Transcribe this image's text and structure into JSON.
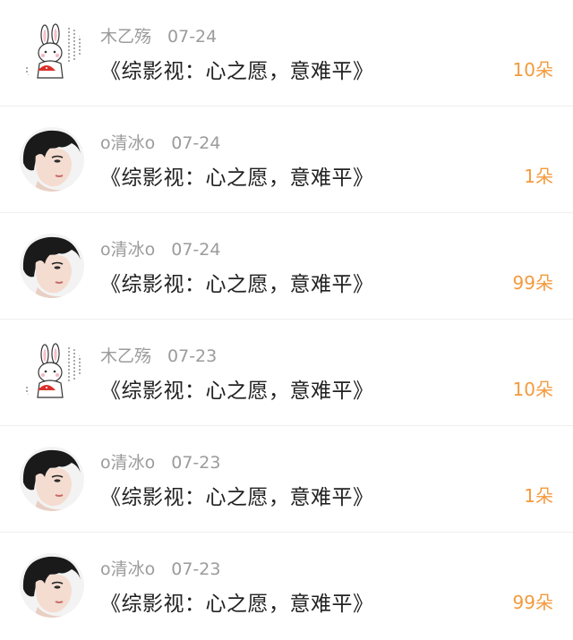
{
  "items": [
    {
      "avatar": "rabbit-avatar",
      "username": "木乙殇",
      "date": "07-24",
      "title": "《综影视：心之愿，意难平》",
      "gift": "10朵"
    },
    {
      "avatar": "portrait-avatar",
      "username": "o清冰o",
      "date": "07-24",
      "title": "《综影视：心之愿，意难平》",
      "gift": "1朵"
    },
    {
      "avatar": "portrait-avatar",
      "username": "o清冰o",
      "date": "07-24",
      "title": "《综影视：心之愿，意难平》",
      "gift": "99朵"
    },
    {
      "avatar": "rabbit-avatar",
      "username": "木乙殇",
      "date": "07-23",
      "title": "《综影视：心之愿，意难平》",
      "gift": "10朵"
    },
    {
      "avatar": "portrait-avatar",
      "username": "o清冰o",
      "date": "07-23",
      "title": "《综影视：心之愿，意难平》",
      "gift": "1朵"
    },
    {
      "avatar": "portrait-avatar",
      "username": "o清冰o",
      "date": "07-23",
      "title": "《综影视：心之愿，意难平》",
      "gift": "99朵"
    }
  ],
  "colors": {
    "gift": "#f39a3d",
    "meta": "#9b9b9b",
    "title": "#222222"
  }
}
